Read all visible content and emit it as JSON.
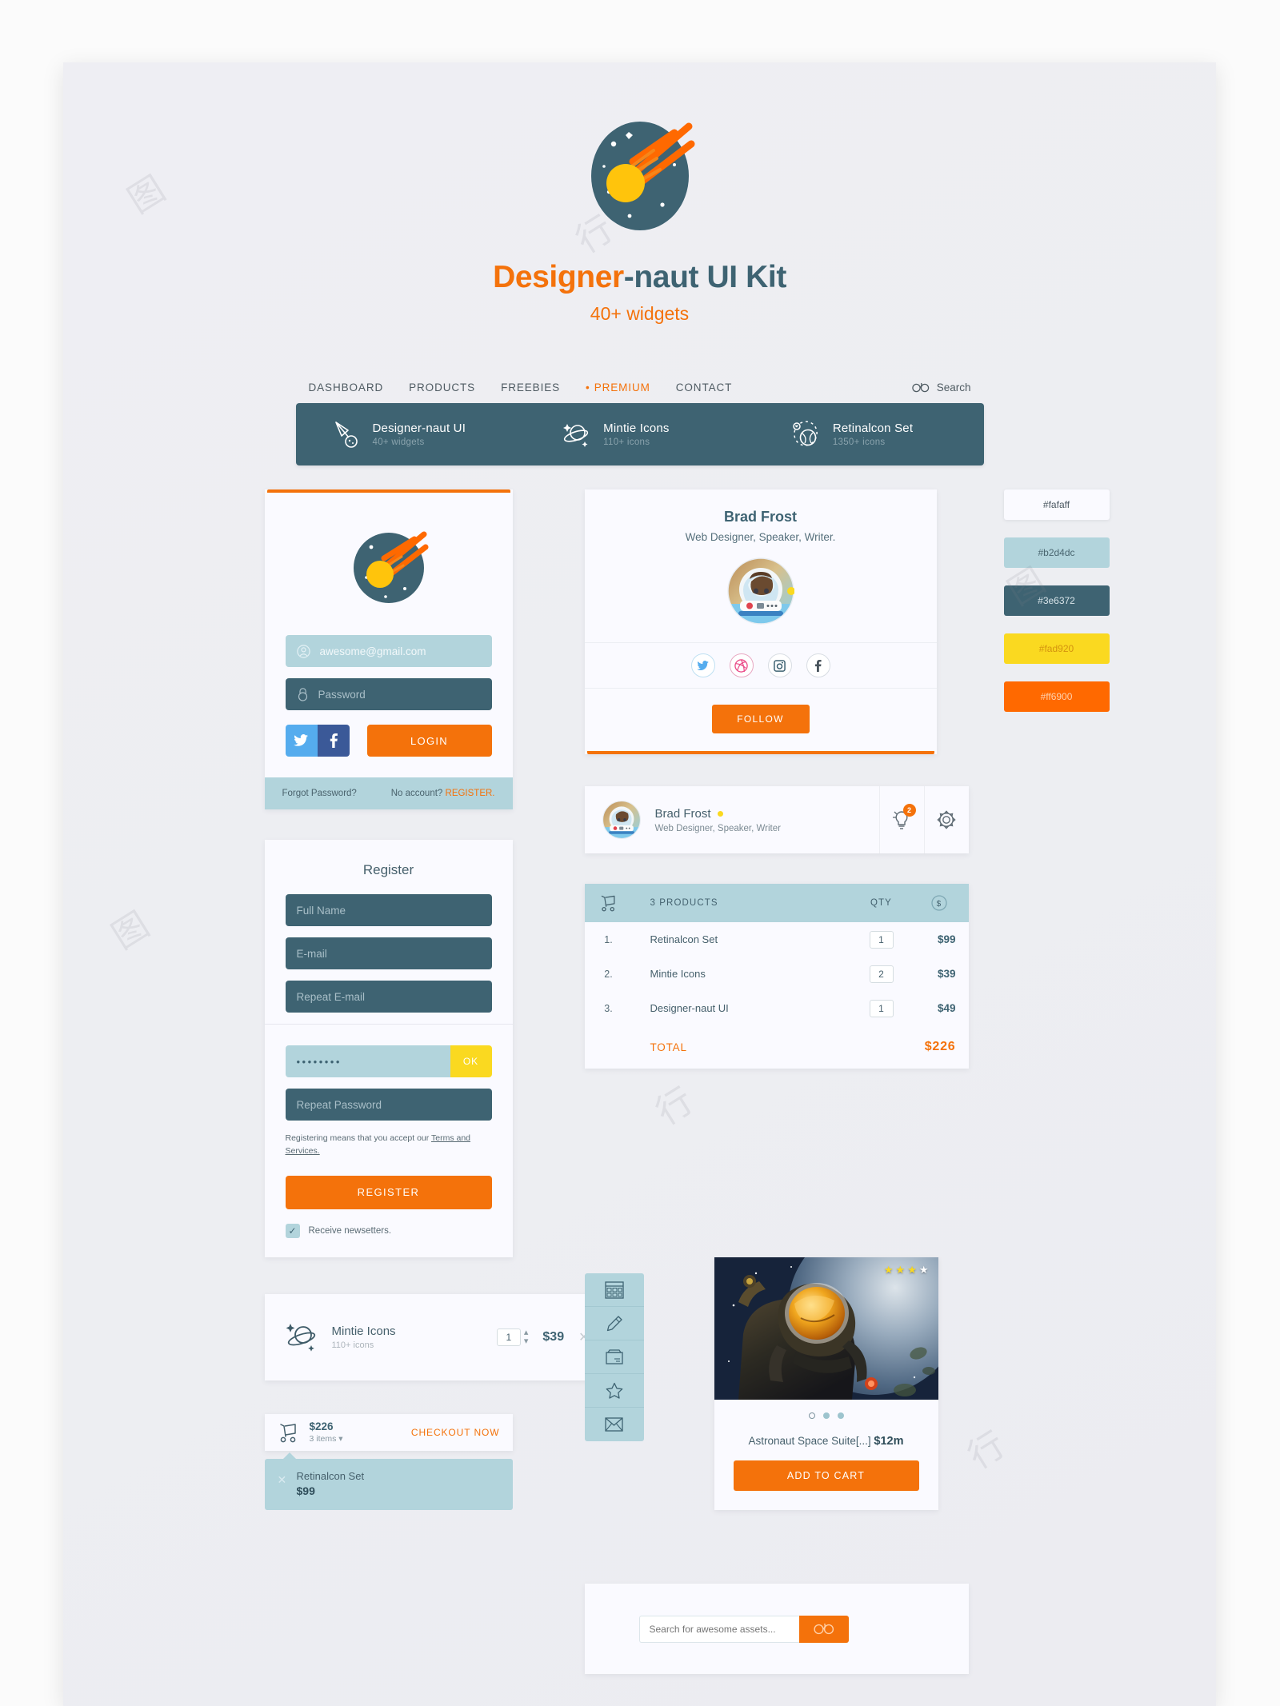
{
  "hero": {
    "title_orange": "Designer",
    "title_rest": "-naut UI Kit",
    "subtitle": "40+ widgets"
  },
  "topnav": {
    "links": [
      {
        "label": "DASHBOARD"
      },
      {
        "label": "PRODUCTS"
      },
      {
        "label": "FREEBIES"
      },
      {
        "label": "PREMIUM"
      },
      {
        "label": "CONTACT"
      }
    ],
    "search_label": "Search"
  },
  "darkbar": {
    "items": [
      {
        "title": "Designer-naut UI",
        "sub": "40+ widgets",
        "icon": "comet-icon"
      },
      {
        "title": "Mintie Icons",
        "sub": "110+ icons",
        "icon": "planet-icon"
      },
      {
        "title": "Retinalcon Set",
        "sub": "1350+ icons",
        "icon": "orbit-globe-icon"
      }
    ]
  },
  "login": {
    "email_value": "awesome@gmail.com",
    "password_placeholder": "Password",
    "login_label": "LOGIN",
    "forgot_label": "Forgot Password?",
    "no_account_label": "No account?",
    "register_link": "REGISTER."
  },
  "register": {
    "title": "Register",
    "fullname_placeholder": "Full Name",
    "email_placeholder": "E-mail",
    "repeat_email_placeholder": "Repeat E-mail",
    "password_value": "••••••••",
    "ok_label": "OK",
    "repeat_password_placeholder": "Repeat Password",
    "terms_prefix": "Registering means that you accept our ",
    "terms_link": "Terms and Services.",
    "register_label": "REGISTER",
    "newsletter_label": "Receive newsetters.",
    "newsletter_checked": "✓"
  },
  "profile": {
    "name": "Brad Frost",
    "role": "Web Designer, Speaker, Writer.",
    "follow_label": "FOLLOW",
    "socials": [
      {
        "name": "twitter-icon"
      },
      {
        "name": "dribbble-icon"
      },
      {
        "name": "instagram-icon"
      },
      {
        "name": "facebook-icon"
      }
    ]
  },
  "userbar": {
    "name": "Brad Frost",
    "role": "Web Designer, Speaker, Writer",
    "notification_count": "2"
  },
  "swatches": [
    {
      "hex": "#fafaff",
      "label": "#fafaff",
      "text": "#4a5760"
    },
    {
      "hex": "#b2d4dc",
      "label": "#b2d4dc",
      "text": "#4a6670"
    },
    {
      "hex": "#3e6372",
      "label": "#3e6372",
      "text": "#d8e4e9"
    },
    {
      "hex": "#fad920",
      "label": "#fad920",
      "text": "#d4930f"
    },
    {
      "hex": "#ff6900",
      "label": "#ff6900",
      "text": "#ffd2ad"
    }
  ],
  "products_table": {
    "header": {
      "count_label": "3 PRODUCTS",
      "qty_label": "QTY",
      "cost_label": "$"
    },
    "rows": [
      {
        "num": "1.",
        "name": "Retinalcon Set",
        "qty": "1",
        "price": "$99"
      },
      {
        "num": "2.",
        "name": "Mintie Icons",
        "qty": "2",
        "price": "$39"
      },
      {
        "num": "3.",
        "name": "Designer-naut UI",
        "qty": "1",
        "price": "$49"
      }
    ],
    "total_label": "TOTAL",
    "total_value": "$226"
  },
  "iconstrip": [
    {
      "name": "browser-window-icon"
    },
    {
      "name": "pencil-icon"
    },
    {
      "name": "archive-box-icon"
    },
    {
      "name": "star-icon"
    },
    {
      "name": "envelope-icon"
    }
  ],
  "product_card": {
    "stars": [
      "filled",
      "filled",
      "filled",
      "white"
    ],
    "dots": [
      "hollow",
      "filled",
      "filled"
    ],
    "name": "Astronaut Space Suite[...]",
    "price": "$12m",
    "cta_label": "ADD TO CART"
  },
  "mintie_row": {
    "name": "Mintie Icons",
    "sub": "110+ icons",
    "qty": "1",
    "price": "$39",
    "remove": "✕"
  },
  "cart_summary": {
    "total": "$226",
    "items_label": "3 items ▾",
    "checkout_label": "CHECKOUT NOW",
    "dropdown": {
      "name": "Retinalcon Set",
      "price": "$99",
      "remove": "✕"
    }
  },
  "search_widget": {
    "placeholder": "Search for awesome assets..."
  },
  "colors": {
    "orange": "#ff6900",
    "dark_teal": "#3e6372",
    "light_teal": "#b2d4dc",
    "yellow": "#fad920",
    "offwhite": "#fafaff"
  }
}
